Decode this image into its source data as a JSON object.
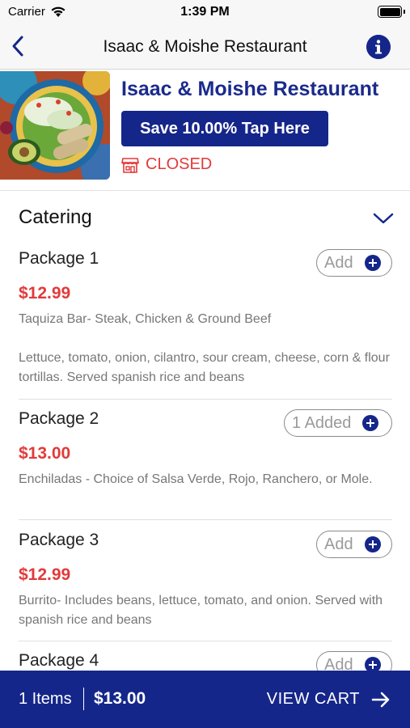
{
  "status_bar": {
    "carrier": "Carrier",
    "time": "1:39 PM"
  },
  "nav": {
    "title": "Isaac & Moishe Restaurant"
  },
  "restaurant": {
    "name": "Isaac & Moishe Restaurant",
    "promo": "Save 10.00% Tap Here",
    "status": "CLOSED"
  },
  "section": {
    "title": "Catering"
  },
  "items": [
    {
      "name": "Package 1",
      "price": "$12.99",
      "button": "Add",
      "description": "Taquiza Bar- Steak, Chicken & Ground Beef\n\nLettuce, tomato, onion, cilantro, sour cream, cheese, corn & flour tortillas. Served spanish rice and beans"
    },
    {
      "name": "Package 2",
      "price": "$13.00",
      "button": "1 Added",
      "description": "Enchiladas - Choice of Salsa Verde, Rojo, Ranchero, or Mole."
    },
    {
      "name": "Package 3",
      "price": "$12.99",
      "button": "Add",
      "description": "Burrito- Includes beans, lettuce, tomato, and onion. Served with spanish rice and beans"
    },
    {
      "name": "Package 4",
      "button": "Add"
    }
  ],
  "cart": {
    "count": "1 Items",
    "total": "$13.00",
    "action": "VIEW CART"
  },
  "colors": {
    "brand": "#15268a",
    "price": "#e23a3a",
    "closed": "#e23a3a"
  }
}
